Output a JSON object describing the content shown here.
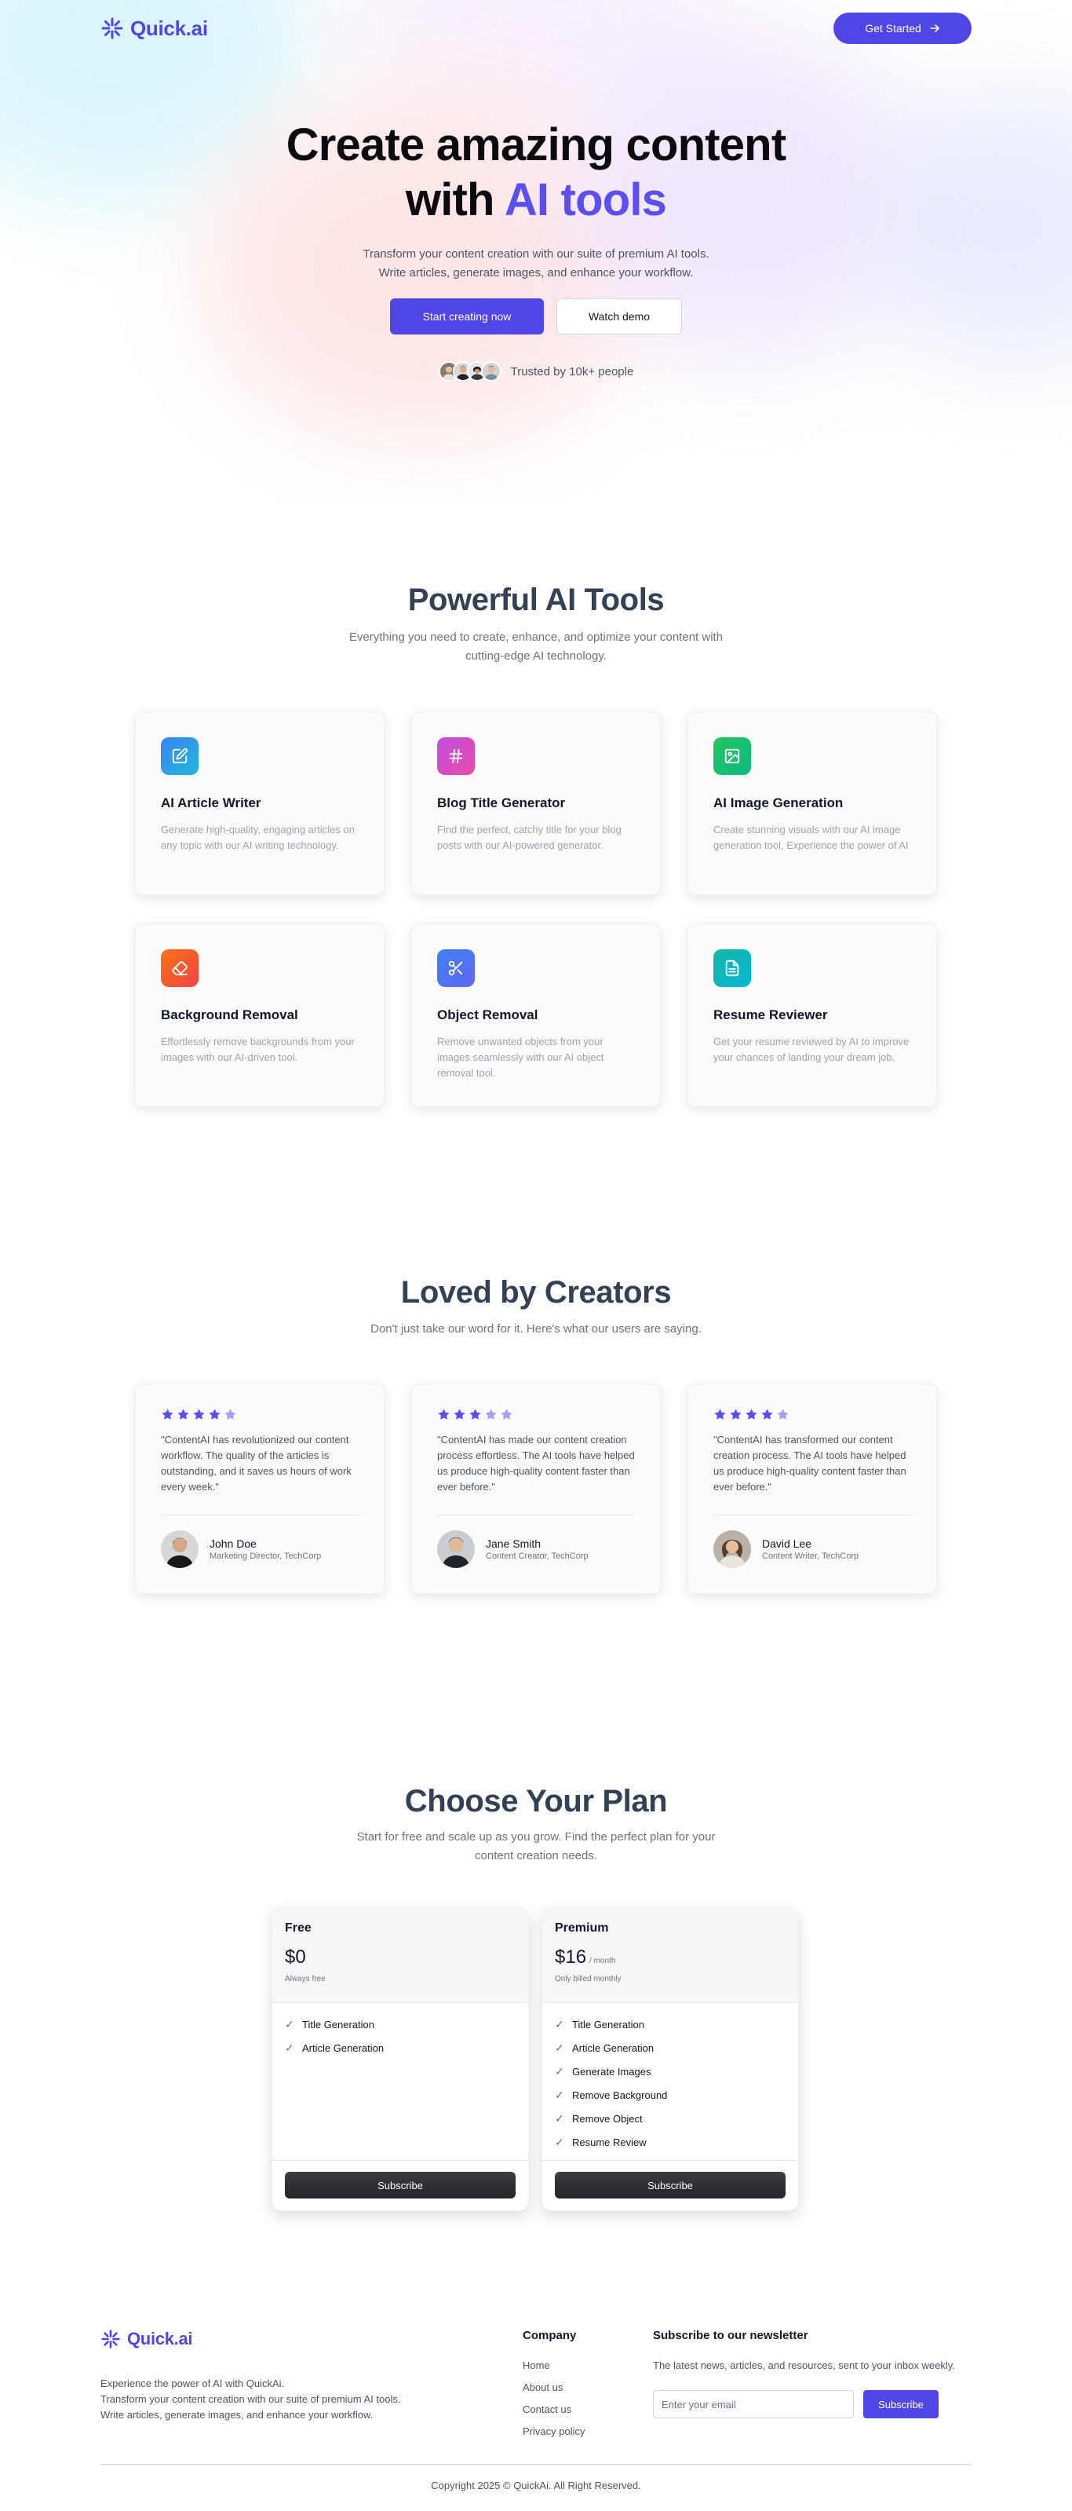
{
  "brand": {
    "name": "Quick.ai",
    "color": "#4f46e5"
  },
  "nav": {
    "cta_label": "Get Started"
  },
  "hero": {
    "title_line1": "Create amazing content",
    "title_line2_prefix": "with",
    "title_line2_accent": "AI tools",
    "subtitle_line1": "Transform your content creation with our suite of premium AI tools.",
    "subtitle_line2": "Write articles, generate images, and enhance your workflow.",
    "primary_btn": "Start creating now",
    "secondary_btn": "Watch demo",
    "trusted": "Trusted by 10k+ people"
  },
  "tools": {
    "title": "Powerful AI Tools",
    "subtitle_line1": "Everything you need to create, enhance, and optimize your content with",
    "subtitle_line2": "cutting-edge AI technology.",
    "items": [
      {
        "icon": "pencil-square-icon",
        "color_from": "#3b82f6",
        "color_to": "#22b8d8",
        "title": "AI Article Writer",
        "desc": "Generate high-quality, engaging articles on any topic with our AI writing technology."
      },
      {
        "icon": "hash-icon",
        "color_from": "#c14fe0",
        "color_to": "#e94aa8",
        "title": "Blog Title Generator",
        "desc": "Find the perfect, catchy title for your blog posts with our AI-powered generator."
      },
      {
        "icon": "image-icon",
        "color_from": "#22c55e",
        "color_to": "#10b981",
        "title": "AI Image Generation",
        "desc": "Create stunning visuals with our AI image generation tool, Experience the power of AI"
      },
      {
        "icon": "eraser-icon",
        "color_from": "#f97316",
        "color_to": "#ef4444",
        "title": "Background Removal",
        "desc": "Effortlessly remove backgrounds from your images with our AI-driven tool."
      },
      {
        "icon": "scissors-icon",
        "color_from": "#3b82f6",
        "color_to": "#6366f1",
        "title": "Object Removal",
        "desc": "Remove unwanted objects from your images seamlessly with our AI object removal tool."
      },
      {
        "icon": "file-text-icon",
        "color_from": "#14b8a6",
        "color_to": "#06b6d4",
        "title": "Resume Reviewer",
        "desc": "Get your resume reviewed by AI to improve your chances of landing your dream job."
      }
    ]
  },
  "testimonials": {
    "title": "Loved by Creators",
    "subtitle": "Don't just take our word for it. Here's what our users are saying.",
    "star_color": "#5b4ff0",
    "star_empty_color": "#a5a0f5",
    "items": [
      {
        "rating": 4,
        "quote": "\"ContentAI has revolutionized our content workflow. The quality of the articles is outstanding, and it saves us hours of work every week.\"",
        "name": "John Doe",
        "role": "Marketing Director, TechCorp"
      },
      {
        "rating": 3,
        "quote": "\"ContentAI has made our content creation process effortless. The AI tools have helped us produce high-quality content faster than ever before.\"",
        "name": "Jane Smith",
        "role": "Content Creator, TechCorp"
      },
      {
        "rating": 4,
        "quote": "\"ContentAI has transformed our content creation process. The AI tools have helped us produce high-quality content faster than ever before.\"",
        "name": "David Lee",
        "role": "Content Writer, TechCorp"
      }
    ]
  },
  "pricing": {
    "title": "Choose Your Plan",
    "subtitle_line1": "Start for free and scale up as you grow. Find the perfect plan for your",
    "subtitle_line2": "content creation needs.",
    "plans": [
      {
        "name": "Free",
        "price": "$0",
        "period": "",
        "note": "Always free",
        "features": [
          "Title Generation",
          "Article Generation"
        ],
        "button": "Subscribe"
      },
      {
        "name": "Premium",
        "price": "$16",
        "period": "/ month",
        "note": "Only billed monthly",
        "features": [
          "Title Generation",
          "Article Generation",
          "Generate Images",
          "Remove Background",
          "Remove Object",
          "Resume Review"
        ],
        "button": "Subscribe"
      }
    ]
  },
  "footer": {
    "desc_line1": "Experience the power of AI with QuickAi.",
    "desc_line2": "Transform your content creation with our suite of premium AI tools. Write articles, generate images, and enhance your workflow.",
    "company_heading": "Company",
    "links": [
      "Home",
      "About us",
      "Contact us",
      "Privacy policy"
    ],
    "newsletter_heading": "Subscribe to our newsletter",
    "newsletter_desc": "The latest news, articles, and resources, sent to your inbox weekly.",
    "email_placeholder": "Enter your email",
    "subscribe_label": "Subscribe",
    "copyright": "Copyright 2025 © QuickAi. All Right Reserved."
  }
}
